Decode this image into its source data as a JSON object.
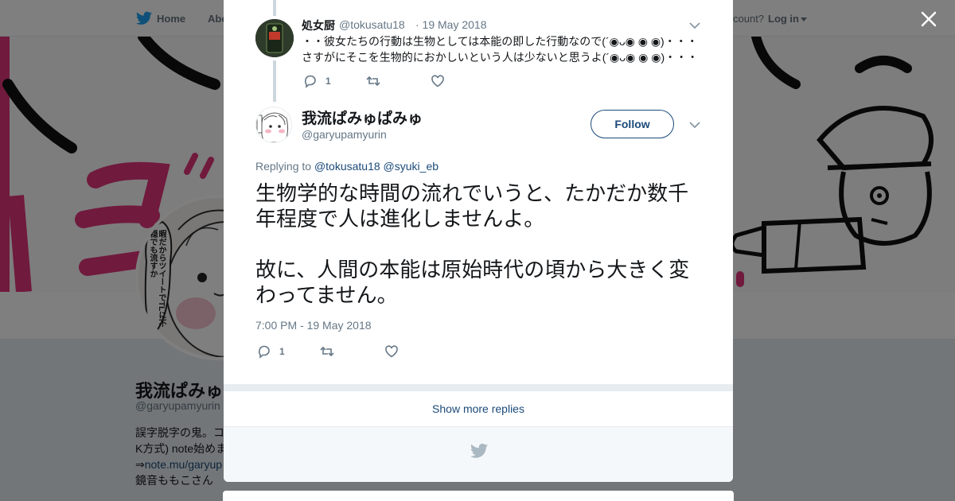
{
  "nav": {
    "home": "Home",
    "about": "Abo",
    "account_prompt": "count?",
    "login": "Log in"
  },
  "profile": {
    "name": "我流ぱみゅ",
    "handle": "@garyupamyurin",
    "bio_line1": "誤字脱字の鬼。コ",
    "bio_line2": "K方式) note始めま",
    "bio_line3_prefix": "⇒",
    "bio_line3_link": "note.mu/garyup",
    "bio_line4": "鏡音ももこさん",
    "avatar_caption": "暇だからツイートでTLに不穏でも流すか"
  },
  "reply_tweet": {
    "name": "処女厨",
    "handle": "@tokusatu18",
    "date": "· 19 May 2018",
    "text_line1": "・・彼女たちの行動は生物としては本能の即した行動なので(´◉ᴗ◉ ◉ ◉)・・・",
    "text_line2": "さすがにそこを生物的におかしいという人は少ないと思うよ(´◉ᴗ◉ ◉ ◉)・・・",
    "reply_count": "1"
  },
  "main_tweet": {
    "name": "我流ぱみゅぱみゅ",
    "handle": "@garyupamyurin",
    "follow_label": "Follow",
    "replying_label": "Replying to",
    "replying_to_1": "@tokusatu18",
    "replying_to_2": "@syuki_eb",
    "text": "生物学的な時間の流れでいうと、たかだか数千年程度で人は進化しませんよ。\n\n故に、人間の本能は原始時代の頃から大きく変わってません。",
    "timestamp": "7:00 PM - 19 May 2018",
    "reply_count": "1"
  },
  "show_more_label": "Show more replies",
  "colors": {
    "link": "#1b4a79",
    "muted": "#657786",
    "banner_pink": "#e0357a"
  },
  "icons": [
    "twitter-bird-icon",
    "close-icon",
    "chevron-down-icon",
    "reply-icon",
    "retweet-icon",
    "like-icon"
  ]
}
